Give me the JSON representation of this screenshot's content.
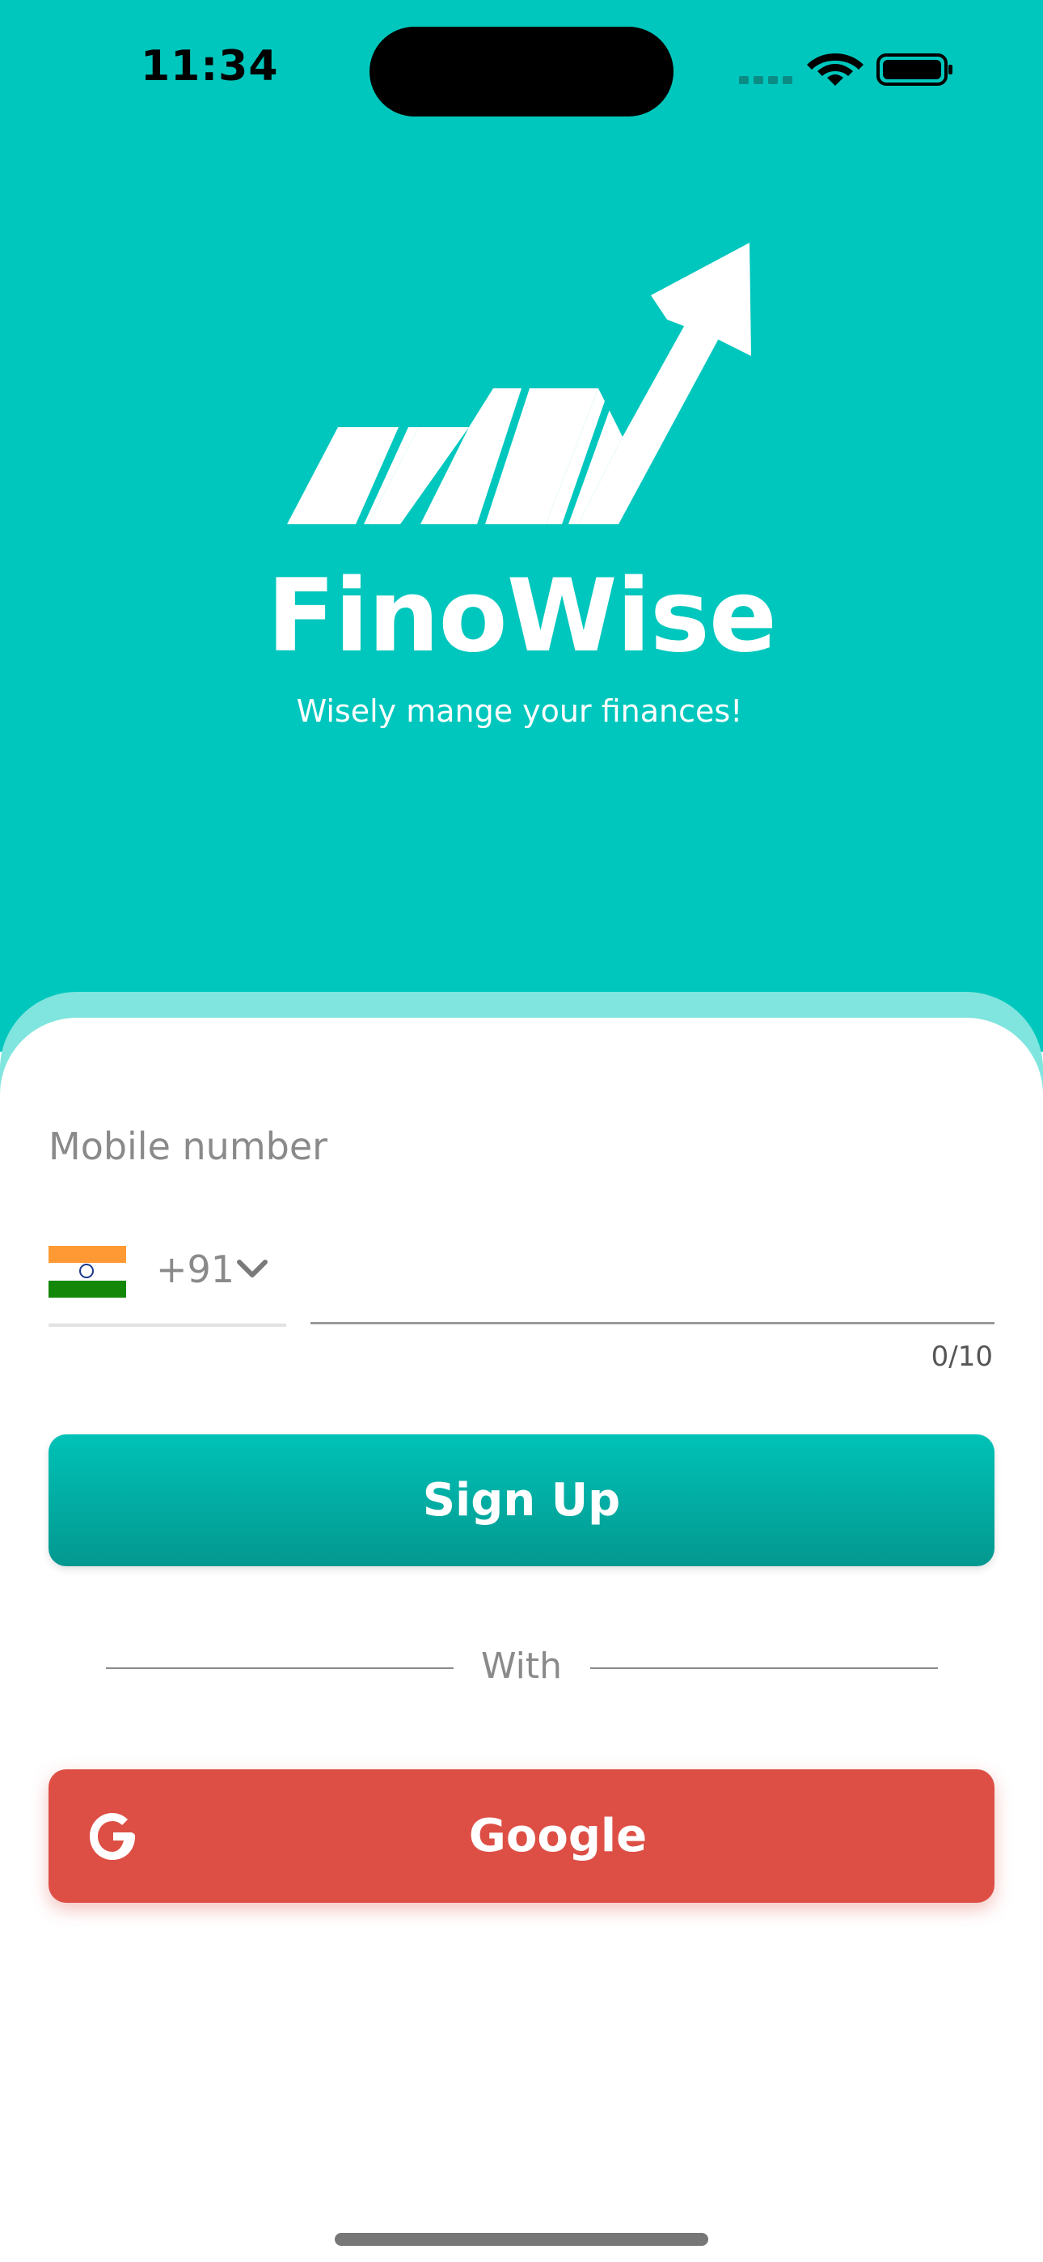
{
  "status_bar": {
    "time": "11:34"
  },
  "brand": {
    "name": "FinoWise",
    "tagline": "Wisely mange your finances!",
    "logo_icon": "rising-arrow-chart-icon"
  },
  "form": {
    "label": "Mobile number",
    "country": {
      "flag_icon": "india-flag-icon",
      "dial_code": "+91"
    },
    "phone_value": "",
    "counter": "0/10"
  },
  "buttons": {
    "signup_label": "Sign Up",
    "divider_label": "With",
    "google_label": "Google"
  },
  "colors": {
    "accent": "#00c7bd",
    "google": "#dd4f45"
  }
}
